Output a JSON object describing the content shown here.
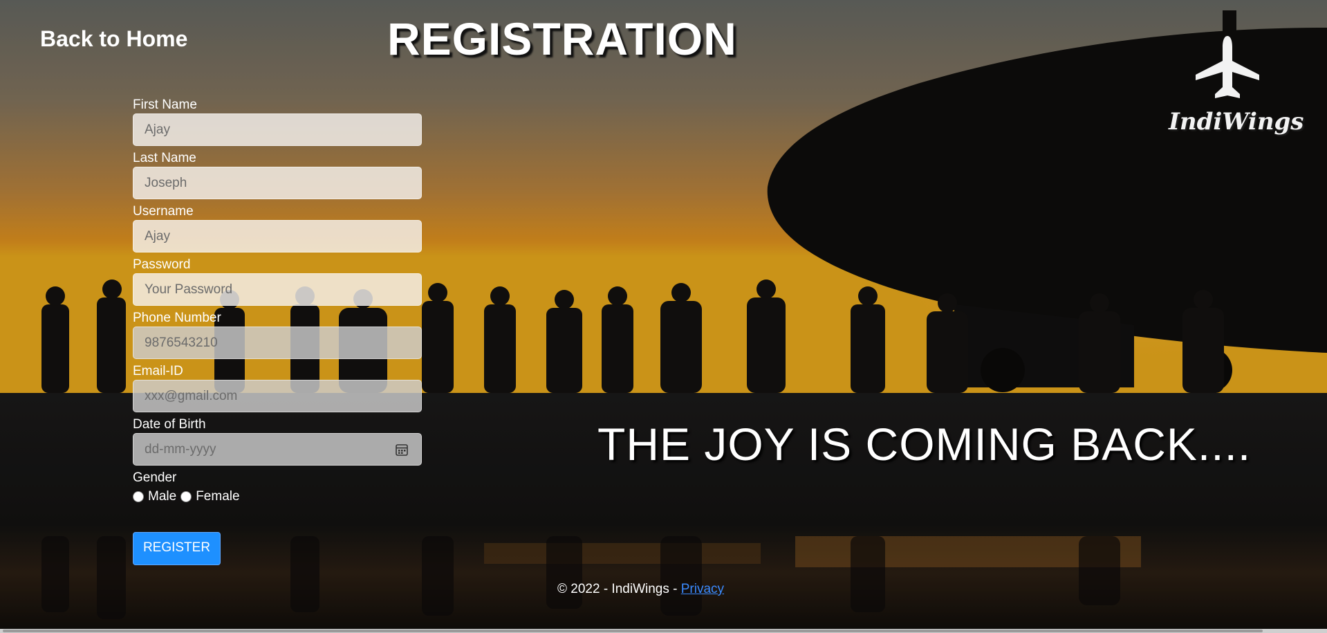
{
  "nav": {
    "back_label": "Back to Home"
  },
  "page": {
    "title": "REGISTRATION",
    "tagline": "THE JOY IS COMING BACK...."
  },
  "brand": {
    "name": "IndiWings",
    "icon": "airplane-icon"
  },
  "form": {
    "fields": [
      {
        "label": "First Name",
        "placeholder": "Ajay"
      },
      {
        "label": "Last Name",
        "placeholder": "Joseph"
      },
      {
        "label": "Username",
        "placeholder": "Ajay"
      },
      {
        "label": "Password",
        "placeholder": "Your Password"
      },
      {
        "label": "Phone Number",
        "placeholder": "9876543210"
      },
      {
        "label": "Email-ID",
        "placeholder": "xxx@gmail.com"
      },
      {
        "label": "Date of Birth",
        "placeholder": "dd-mm-yyyy"
      }
    ],
    "gender": {
      "label": "Gender",
      "options": [
        "Male",
        "Female"
      ]
    },
    "submit_label": "REGISTER"
  },
  "footer": {
    "text": "© 2022 - IndiWings - ",
    "link": "Privacy"
  },
  "colors": {
    "button": "#1e90ff",
    "link": "#3b8bff",
    "sunset": "#f7a21a"
  }
}
